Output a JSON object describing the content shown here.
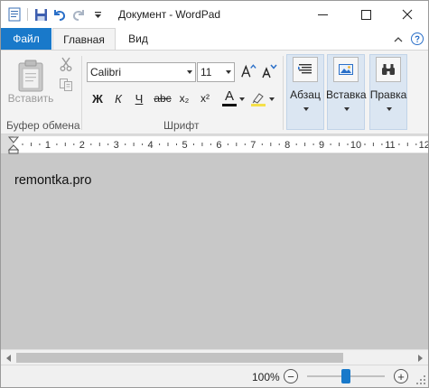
{
  "window": {
    "title_doc": "Документ",
    "title_sep": "-",
    "title_app": "WordPad"
  },
  "tabs": [
    {
      "label": "Файл"
    },
    {
      "label": "Главная"
    },
    {
      "label": "Вид"
    }
  ],
  "clipboard": {
    "paste_label": "Вставить",
    "group_label": "Буфер обмена"
  },
  "font": {
    "name": "Calibri",
    "size": "11",
    "group_label": "Шрифт",
    "bold": "Ж",
    "italic": "К",
    "underline": "Ч",
    "strike": "abc",
    "subscript": "x₂",
    "superscript": "x²",
    "color_letter": "A"
  },
  "big_buttons": [
    {
      "label": "Абзац"
    },
    {
      "label": "Вставка"
    },
    {
      "label": "Правка"
    }
  ],
  "ruler": {
    "labels": [
      "1",
      "2",
      "3",
      "4",
      "5",
      "6",
      "7",
      "8",
      "9",
      "10",
      "11",
      "12"
    ]
  },
  "document": {
    "text": "remontka.pro"
  },
  "status": {
    "zoom": "100%",
    "zoom_out": "−",
    "zoom_in": "+",
    "zoom_level": 0.5
  },
  "colors": {
    "accent": "#1979ca",
    "font_color_bar": "#111111",
    "highlight_bar": "#f5e04a"
  }
}
